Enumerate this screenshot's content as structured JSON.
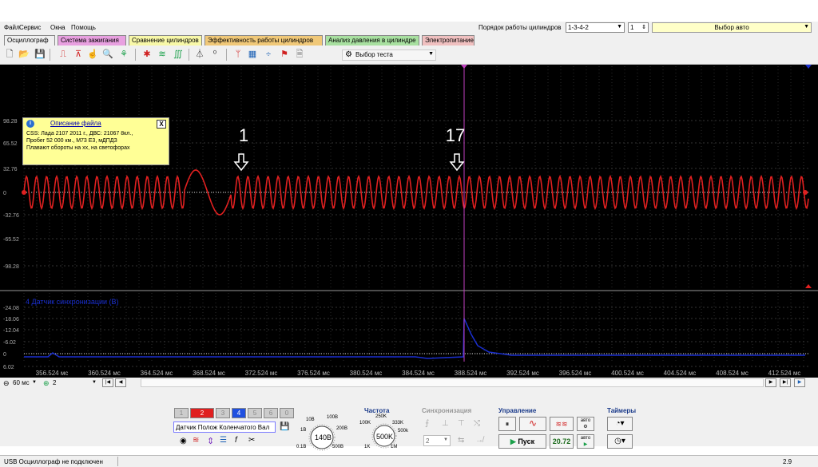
{
  "menu": [
    "Файл",
    "Сервис",
    "Окна",
    "Помощь"
  ],
  "cylinder_order": {
    "label": "Порядок работы цилиндров",
    "value": "1-3-4-2",
    "num": "1"
  },
  "auto_select": "Выбор авто",
  "tabs": [
    {
      "label": "Осциллограф",
      "color": "#f0f0f0"
    },
    {
      "label": "Система зажигания",
      "color": "#e8a0e0"
    },
    {
      "label": "Сравнение цилиндров",
      "color": "#f8f8a8"
    },
    {
      "label": "Эффективность работы цилиндров",
      "color": "#f0c878"
    },
    {
      "label": "Анализ давления в цилиндре",
      "color": "#a8e0a0"
    },
    {
      "label": "Электропитание",
      "color": "#f0c0c0"
    }
  ],
  "test_select": "Выбор теста",
  "info": {
    "title": "Описание файла",
    "lines": [
      "CSS: Лада 2107 2011 г., ДВС: 21067 8кл.,",
      "Пробег 52 000 км., М73 Е3, мДПДЗ",
      "Плавают обороты на хх, на светофорах"
    ],
    "close": "X"
  },
  "channel1": {
    "yticks": [
      "98.28",
      "65.52",
      "32.76",
      "0",
      "-32.76",
      "-65.52",
      "-98.28"
    ]
  },
  "channel2": {
    "name": "4 Датчик синхронизации (В)",
    "yticks": [
      "-24.08",
      "-18.06",
      "-12.04",
      "-6.02",
      "0",
      "6.02"
    ]
  },
  "annotations": [
    {
      "text": "1"
    },
    {
      "text": "17"
    }
  ],
  "xticks": [
    "356.524 мс",
    "360.524 мс",
    "364.524 мс",
    "368.524 мс",
    "372.524 мс",
    "376.524 мс",
    "380.524 мс",
    "384.524 мс",
    "388.524 мс",
    "392.524 мс",
    "396.524 мс",
    "400.524 мс",
    "404.524 мс",
    "408.524 мс",
    "412.524 мс"
  ],
  "timebase": "60 мс",
  "channel_sel": "2",
  "channels": [
    "1",
    "2",
    "3",
    "4",
    "5",
    "6",
    "0"
  ],
  "sensor": "Датчик Полож Коленчатого Вал",
  "volt": {
    "value": "140В",
    "labels": [
      "10В",
      "100В",
      "1В",
      "200В",
      "0.1В",
      "500В"
    ]
  },
  "freq": {
    "title": "Частота",
    "value": "500K",
    "labels": [
      "250K",
      "100K",
      "333K",
      "500k",
      "1K",
      "1M"
    ]
  },
  "sync": {
    "title": "Синхронизация",
    "value": "2"
  },
  "control": {
    "title": "Управление",
    "start": "Пуск",
    "value": "20.72",
    "auto": "авто"
  },
  "timers": {
    "title": "Таймеры"
  },
  "status": {
    "left": "USB Осциллограф не подключен",
    "right": "2.9"
  }
}
